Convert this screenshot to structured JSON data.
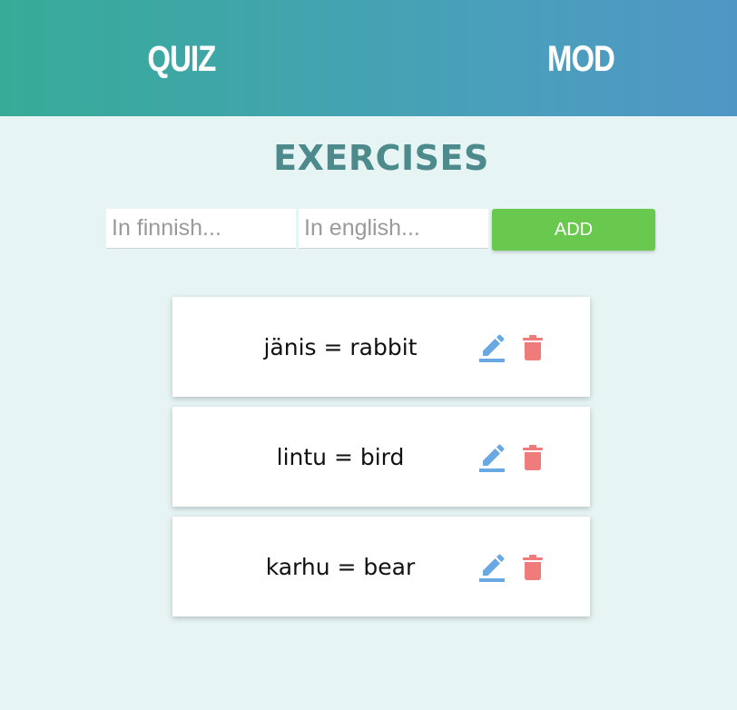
{
  "nav": {
    "quiz_label": "QUIZ",
    "mod_label": "MOD"
  },
  "page": {
    "title": "EXERCISES"
  },
  "form": {
    "finnish_placeholder": "In finnish...",
    "english_placeholder": "In english...",
    "add_label": "ADD"
  },
  "exercises": [
    {
      "text": "jänis = rabbit"
    },
    {
      "text": "lintu = bird"
    },
    {
      "text": "karhu = bear"
    }
  ],
  "icons": {
    "edit": "pencil-icon",
    "delete": "trash-icon"
  },
  "colors": {
    "header_start": "#37ab98",
    "header_end": "#5096c5",
    "title": "#4c8a8c",
    "add_button": "#69c94f",
    "edit_icon": "#6aa8e4",
    "delete_icon": "#ef7b7b"
  }
}
